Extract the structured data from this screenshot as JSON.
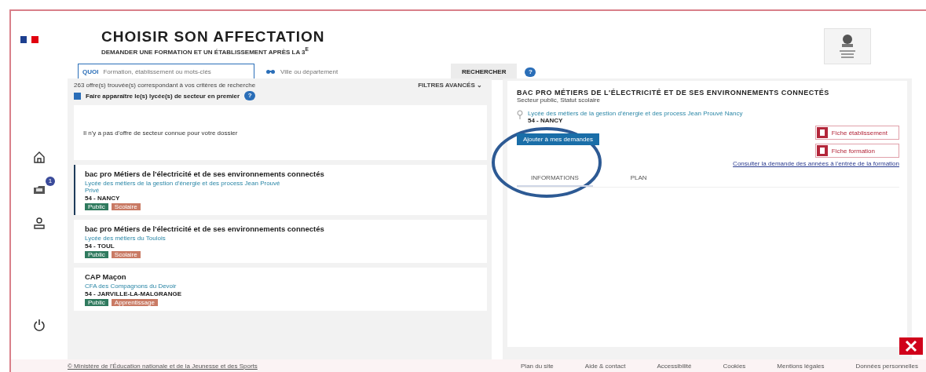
{
  "header": {
    "title": "CHOISIR SON AFFECTATION",
    "subtitle": "DEMANDER UNE FORMATION ET UN ÉTABLISSEMENT APRÈS LA 3$^{E}$"
  },
  "search": {
    "what_label": "QUOI",
    "what_placeholder": "Formation, établissement ou mots-clés",
    "where_placeholder": "Ville ou département",
    "button": "RECHERCHER",
    "help": "?"
  },
  "sidebar": {
    "items": [
      {
        "kind": "home",
        "selected": false
      },
      {
        "kind": "folder",
        "selected": false,
        "badge": "1"
      },
      {
        "kind": "user",
        "selected": false
      }
    ]
  },
  "results": {
    "count_text": "263 offre(s) trouvée(s) correspondant à vos critères de recherche",
    "filters": "FILTRES AVANCÉS ⌄",
    "sector_first": {
      "label": "Faire apparaître le(s) lycée(s) de secteur en premier",
      "checked": true,
      "help": "?"
    },
    "empty_message": "Il n'y a pas d'offre de secteur connue pour votre dossier",
    "cards": [
      {
        "title": "bac pro Métiers de l'électricité et de ses environnements connectés",
        "school": "Lycée des métiers de la gestion d'énergie et des process Jean Prouvé",
        "status": "Privé",
        "city": "54 - NANCY",
        "tags": [
          "Public",
          "Scolaire"
        ],
        "selected": true
      },
      {
        "title": "bac pro Métiers de l'électricité et de ses environnements connectés",
        "school": "Lycée des métiers du Toulois",
        "city": "54 - TOUL",
        "tags": [
          "Public",
          "Scolaire"
        ],
        "selected": false
      },
      {
        "title": "CAP Maçon",
        "school": "CFA des Compagnons du Devoir",
        "city": "54 - JARVILLE-LA-MALGRANGE",
        "tags": [
          "Public",
          "Apprentissage"
        ],
        "selected": false
      }
    ]
  },
  "detail": {
    "title": "BAC PRO MÉTIERS DE L'ÉLECTRICITÉ ET DE SES ENVIRONNEMENTS CONNECTÉS",
    "subtitle": "Secteur public, Statut scolaire",
    "school": "Lycée des métiers de la gestion d'énergie et des process Jean Prouvé Nancy",
    "city": "54 - NANCY",
    "add_button": "Ajouter à mes demandes",
    "sheet_buttons": [
      "Fiche établissement",
      "Fiche formation"
    ],
    "demand_link": "Consulter la demande des années à l'entrée de la formation",
    "tabs": [
      {
        "label": "INFORMATIONS",
        "selected": true
      },
      {
        "label": "PLAN",
        "selected": false
      }
    ]
  },
  "footer": {
    "copyright": "© Ministère de l'Éducation nationale et de la Jeunesse et des Sports",
    "links": [
      "Plan du site",
      "Aide & contact",
      "Accessibilité",
      "Cookies",
      "Mentions légales",
      "Données personnelles"
    ]
  }
}
